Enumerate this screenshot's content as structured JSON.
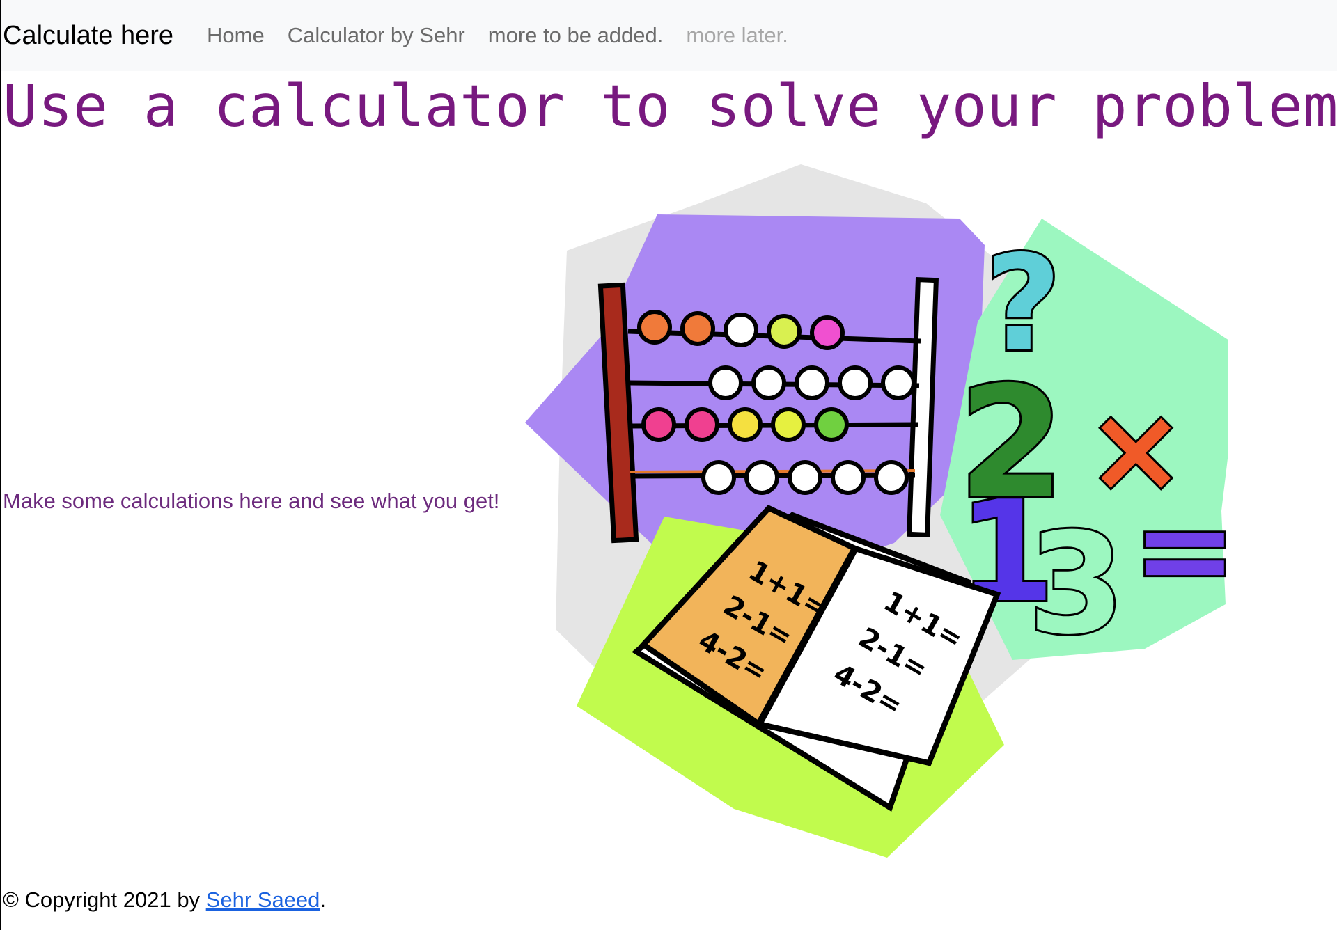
{
  "navbar": {
    "brand": "Calculate here",
    "links": [
      {
        "label": "Home"
      },
      {
        "label": "Calculator by Sehr"
      },
      {
        "label": "more to be added."
      },
      {
        "label": "more later."
      }
    ]
  },
  "main": {
    "headline": "Use a calculator to solve your problems",
    "tagline": "Make some calculations here and see what you get!"
  },
  "illustration": {
    "book_left_lines": [
      "1+1=",
      "2-1=",
      "4-2="
    ],
    "book_right_lines": [
      "1+1=",
      "2-1=",
      "4-2="
    ],
    "symbols": [
      "?",
      "2",
      "×",
      "1",
      "3",
      "="
    ]
  },
  "footer": {
    "prefix": "© Copyright 2021 by ",
    "author": "Sehr Saeed",
    "suffix": "."
  },
  "colors": {
    "headline": "#78197f",
    "tagline": "#6c2a7d",
    "link": "#1a62e0",
    "navbar_bg": "#f8f9fa"
  }
}
